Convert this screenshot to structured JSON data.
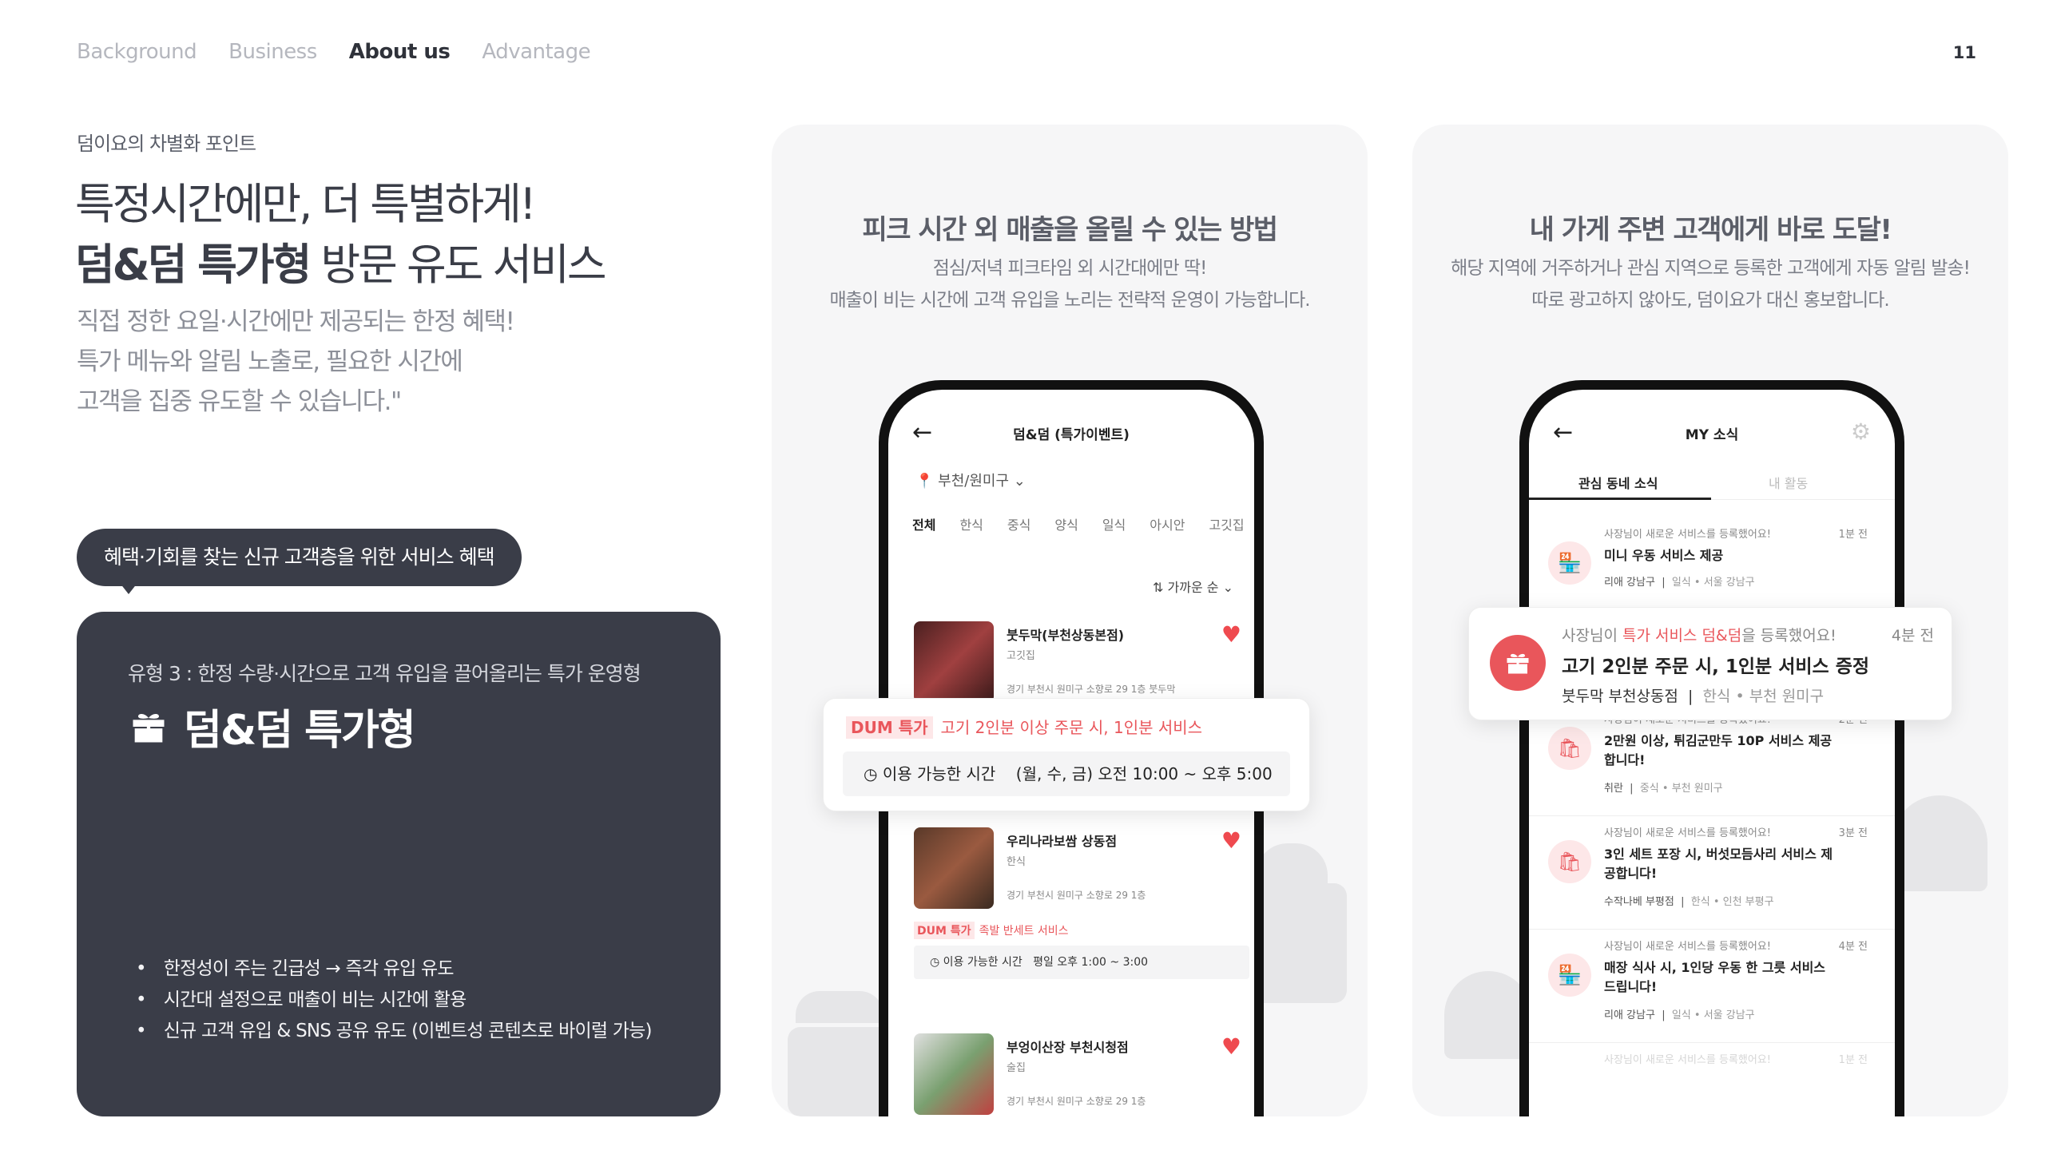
{
  "nav": {
    "items": [
      "Background",
      "Business",
      "About us",
      "Advantage"
    ],
    "active": "About us",
    "page_number": "11"
  },
  "left": {
    "kicker": "덤이요의 차별화 포인트",
    "headline_line1": "특정시간에만, 더 특별하게!",
    "headline_bold": "덤&덤 특가형",
    "headline_rest": " 방문 유도 서비스",
    "sub_line1": "직접 정한 요일·시간에만 제공되는 한정 혜택!",
    "sub_line2": "특가 메뉴와 알림 노출로, 필요한 시간에",
    "sub_line3": "고객을 집중 유도할 수 있습니다.\"",
    "pill": "혜택·기회를 찾는 신규 고객층을 위한 서비스 혜택",
    "card_type": "유형 3 : 한정 수량·시간으로 고객 유입을 끌어올리는 특가 운영형",
    "card_title": "덤&덤 특가형",
    "bullets": [
      "한정성이 주는 긴급성 → 즉각 유입 유도",
      "시간대 설정으로 매출이 비는 시간에 활용",
      "신규 고객 유입 & SNS 공유 유도 (이벤트성 콘텐츠로 바이럴 가능)"
    ]
  },
  "panel1": {
    "title": "피크 시간 외 매출을 올릴 수 있는 방법",
    "desc1": "점심/저녁 피크타임 외 시간대에만 딱!",
    "desc2": "매출이 비는 시간에 고객 유입을 노리는 전략적 운영이 가능합니다.",
    "screen_title": "덤&덤 (특가이벤트)",
    "location": "부천/원미구",
    "categories": [
      "전체",
      "한식",
      "중식",
      "양식",
      "일식",
      "아시안",
      "고깃집"
    ],
    "sort": "가까운 순",
    "shops": [
      {
        "name": "붓두막(부천상동본점)",
        "category": "고깃집",
        "address": "경기 부천시 원미구 소향로 29 1층 붓두막"
      },
      {
        "name": "우리나라보쌈 상동점",
        "category": "한식",
        "address": "경기 부천시 원미구 소향로 29 1층"
      },
      {
        "name": "부엉이산장 부천시청점",
        "category": "술집",
        "address": "경기 부천시 원미구 소향로 29 1층"
      }
    ],
    "float_badge": "DUM 특가",
    "float_offer": "고기 2인분 이상 주문 시, 1인분 서비스",
    "float_time_label": "이용 가능한 시간",
    "float_time_value": "(월, 수, 금) 오전 10:00 ~ 오후 5:00",
    "mini_badge": "DUM 특가",
    "mini_offer": "족발 반세트 서비스",
    "mini_time_label": "이용 가능한 시간",
    "mini_time_value": "평일 오후 1:00 ~ 3:00"
  },
  "panel2": {
    "title": "내 가게 주변 고객에게 바로 도달!",
    "desc1": "해당 지역에 거주하거나 관심 지역으로 등록한 고객에게 자동 알림 발송!",
    "desc2": "따로 광고하지 않아도, 덤이요가 대신 홍보합니다.",
    "screen_title": "MY 소식",
    "tab_active": "관심 동네 소식",
    "tab_inactive": "내 활동",
    "float_prefix": "사장님이 ",
    "float_highlight": "특가 서비스 덤&덤",
    "float_suffix": "을 등록했어요!",
    "float_time": "4분 전",
    "float_main": "고기 2인분 주문 시, 1인분 서비스 증정",
    "float_shop": "붓두막 부천상동점",
    "float_meta": "한식 • 부천 원미구",
    "notifs": [
      {
        "small": "사장님이 새로운 서비스를 등록했어요!",
        "time": "1분 전",
        "main": "미니 우동 서비스 제공",
        "shop": "리애 강남구",
        "meta": "일식 • 서울 강남구"
      },
      {
        "small": "사장님이 새로운 서비스를 등록했어요!",
        "time": "2분 전",
        "main": "2만원 이상, 튀김군만두 10P 서비스 제공합니다!",
        "shop": "취란",
        "meta": "중식 • 부천 원미구"
      },
      {
        "small": "사장님이 새로운 서비스를 등록했어요!",
        "time": "3분 전",
        "main": "3인 세트 포장 시, 버섯모듬사리 서비스 제공합니다!",
        "shop": "수작나베 부평점",
        "meta": "한식 • 인천 부평구"
      },
      {
        "small": "사장님이 새로운 서비스를 등록했어요!",
        "time": "4분 전",
        "main": "매장 식사 시, 1인당 우동 한 그릇 서비스 드립니다!",
        "shop": "리애 강남구",
        "meta": "일식 • 서울 강남구"
      },
      {
        "small": "사장님이 새로운 서비스를 등록했어요!",
        "time": "1분 전",
        "main": "",
        "shop": "",
        "meta": ""
      }
    ]
  },
  "colors": {
    "dark": "#3a3d48",
    "accent": "#e9565b",
    "panel_bg": "#f6f6f7"
  }
}
